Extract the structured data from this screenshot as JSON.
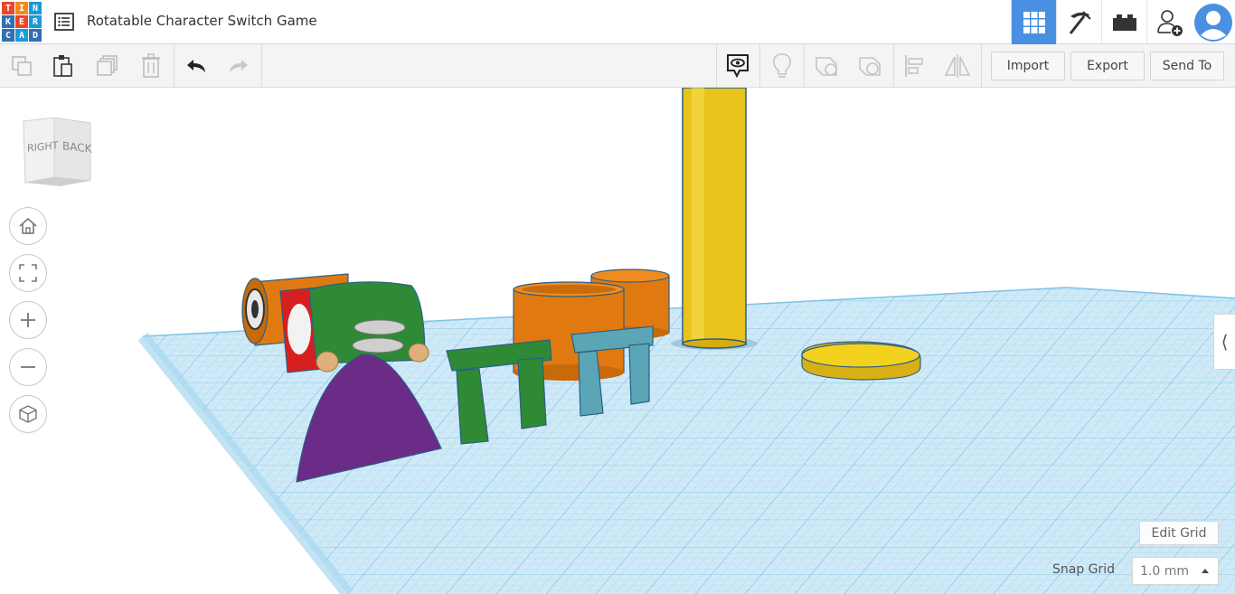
{
  "app": {
    "logo_letters": [
      "T",
      "I",
      "N",
      "K",
      "E",
      "R",
      "C",
      "A",
      "D"
    ],
    "title": "Rotatable Character Switch Game"
  },
  "top_right": {
    "items": [
      {
        "icon": "grid-view-icon",
        "active": true
      },
      {
        "icon": "pickaxe-icon",
        "active": false
      },
      {
        "icon": "brick-icon",
        "active": false
      },
      {
        "icon": "add-user-icon",
        "active": false
      },
      {
        "icon": "avatar-icon",
        "active": false
      }
    ]
  },
  "toolbar": {
    "tools": [
      "copy-icon",
      "paste-icon",
      "duplicate-icon",
      "delete-icon",
      "undo-icon",
      "redo-icon",
      "note-icon",
      "light-icon",
      "shape-icon",
      "hole-icon",
      "align-icon",
      "mirror-icon"
    ],
    "import_label": "Import",
    "export_label": "Export",
    "send_to_label": "Send To"
  },
  "viewcube": {
    "right_label": "RIGHT",
    "back_label": "BACK"
  },
  "view_controls": [
    "home-icon",
    "fit-icon",
    "zoom-in-icon",
    "zoom-out-icon",
    "perspective-icon"
  ],
  "grid": {
    "edit_grid_label": "Edit Grid",
    "snap_grid_label": "Snap Grid",
    "snap_value": "1.0 mm"
  },
  "colors": {
    "accent": "#4a90e2",
    "grid_fill": "#cfe9f7",
    "grid_line": "#8ccbea",
    "yellow": "#e8c31c",
    "orange": "#e07a10",
    "green": "#2e8a35",
    "teal": "#5aa6b6",
    "purple": "#6a2c86"
  }
}
